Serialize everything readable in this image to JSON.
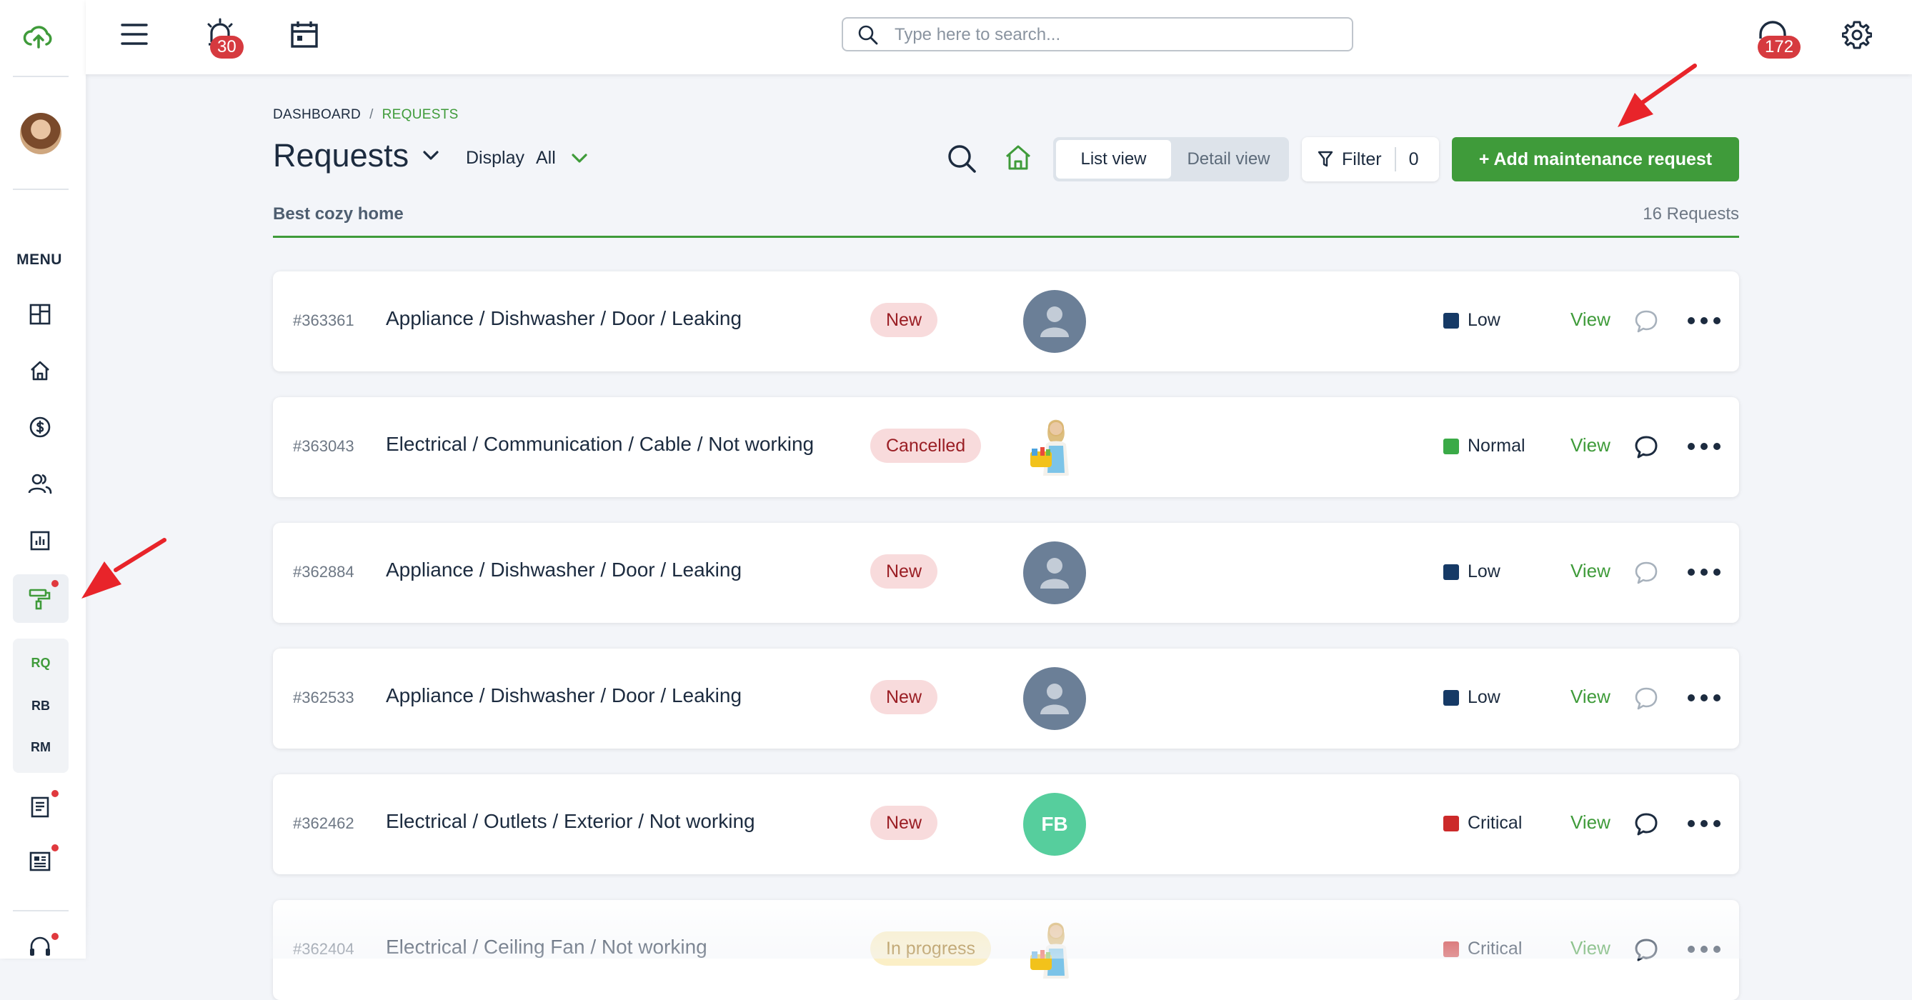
{
  "topbar": {
    "alarm_badge": "30",
    "support_badge": "172",
    "search_placeholder": "Type here to search..."
  },
  "sidebar": {
    "menu_label": "MENU",
    "subitems": [
      {
        "label": "RQ",
        "active": true
      },
      {
        "label": "RB",
        "active": false
      },
      {
        "label": "RM",
        "active": false
      }
    ]
  },
  "breadcrumb": {
    "dashboard": "DASHBOARD",
    "separator": "/",
    "current": "REQUESTS"
  },
  "header": {
    "title": "Requests",
    "display_label": "Display",
    "display_value": "All",
    "list_view": "List view",
    "detail_view": "Detail view",
    "filter_label": "Filter",
    "filter_count": "0",
    "add_button": "+ Add maintenance request",
    "property_name": "Best cozy home",
    "request_count": "16 Requests"
  },
  "colors": {
    "accent_green": "#3f9b3a",
    "priority_low": "#163a66",
    "priority_normal": "#3aaa47",
    "priority_critical": "#cc2a2a"
  },
  "requests": [
    {
      "id": "#363361",
      "title": "Appliance / Dishwasher / Door / Leaking",
      "status": "New",
      "avatar": "placeholder",
      "priority": "Low",
      "view": "View",
      "chat": "empty"
    },
    {
      "id": "#363043",
      "title": "Electrical / Communication / Cable / Not working",
      "status": "Cancelled",
      "avatar": "photo",
      "priority": "Normal",
      "view": "View",
      "chat": "filled"
    },
    {
      "id": "#362884",
      "title": "Appliance / Dishwasher / Door / Leaking",
      "status": "New",
      "avatar": "placeholder",
      "priority": "Low",
      "view": "View",
      "chat": "empty"
    },
    {
      "id": "#362533",
      "title": "Appliance / Dishwasher / Door / Leaking",
      "status": "New",
      "avatar": "placeholder",
      "priority": "Low",
      "view": "View",
      "chat": "empty"
    },
    {
      "id": "#362462",
      "title": "Electrical / Outlets / Exterior / Not working",
      "status": "New",
      "avatar": "FB",
      "priority": "Critical",
      "view": "View",
      "chat": "filled"
    },
    {
      "id": "#362404",
      "title": "Electrical / Ceiling Fan / Not working",
      "status": "In progress",
      "avatar": "photo",
      "priority": "Critical",
      "view": "View",
      "chat": "filled"
    }
  ]
}
